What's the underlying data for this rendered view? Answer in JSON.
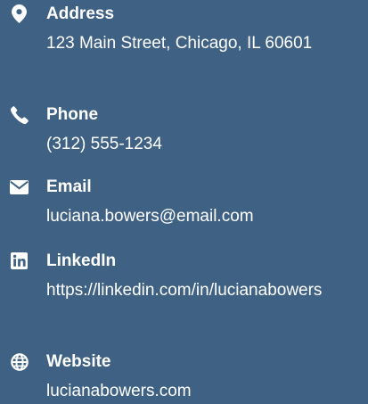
{
  "contact": {
    "items": [
      {
        "icon": "map-pin-icon",
        "label": "Address",
        "value": "123 Main Street, Chicago, IL 60601"
      },
      {
        "icon": "phone-icon",
        "label": "Phone",
        "value": "(312) 555-1234"
      },
      {
        "icon": "envelope-icon",
        "label": "Email",
        "value": "luciana.bowers@email.com"
      },
      {
        "icon": "linkedin-icon",
        "label": "LinkedIn",
        "value": "https://linkedin.com/in/lucianabowers"
      },
      {
        "icon": "globe-icon",
        "label": "Website",
        "value": "lucianabowers.com"
      }
    ]
  },
  "colors": {
    "background": "#3f6284",
    "text": "#ffffff"
  }
}
